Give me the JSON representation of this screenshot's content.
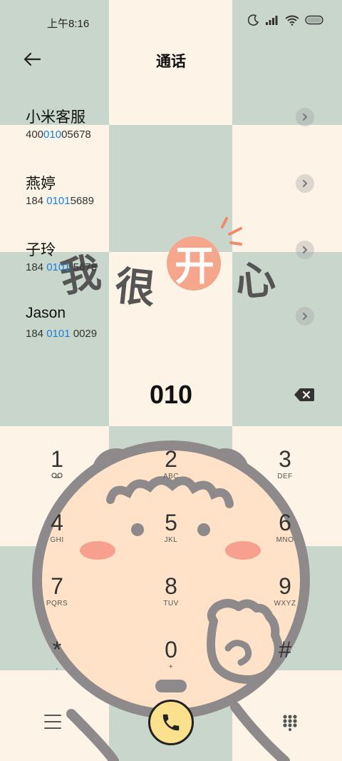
{
  "status": {
    "time": "上午8:16"
  },
  "header": {
    "title": "通话"
  },
  "contacts": [
    {
      "name": "小米客服",
      "num_pre": "400",
      "num_hl": "010",
      "num_post": "05678"
    },
    {
      "name": "燕婷",
      "num_pre": "184 ",
      "num_hl": "0101",
      "num_post": "5689"
    },
    {
      "name": "子玲",
      "num_pre": "184 ",
      "num_hl": "0101",
      "num_post": " 5678"
    },
    {
      "name": "Jason",
      "num_pre": "184 ",
      "num_hl": "0101",
      "num_post": " 0029"
    }
  ],
  "dialer": {
    "digits": "010",
    "keys": [
      {
        "digit": "1",
        "letters": ""
      },
      {
        "digit": "2",
        "letters": "ABC"
      },
      {
        "digit": "3",
        "letters": "DEF"
      },
      {
        "digit": "4",
        "letters": "GHI"
      },
      {
        "digit": "5",
        "letters": "JKL"
      },
      {
        "digit": "6",
        "letters": "MNO"
      },
      {
        "digit": "7",
        "letters": "PQRS"
      },
      {
        "digit": "8",
        "letters": "TUV"
      },
      {
        "digit": "9",
        "letters": "WXYZ"
      },
      {
        "digit": "*",
        "letters": ","
      },
      {
        "digit": "0",
        "letters": "+"
      },
      {
        "digit": "#",
        "letters": ""
      }
    ]
  },
  "wallpaper_text": [
    "我",
    "很",
    "开",
    "心"
  ],
  "colors": {
    "highlight": "#1a7fd8",
    "call_button": "#fbe08e",
    "green_tile": "#c8d6cc",
    "cream_tile": "#fdf3e6"
  }
}
